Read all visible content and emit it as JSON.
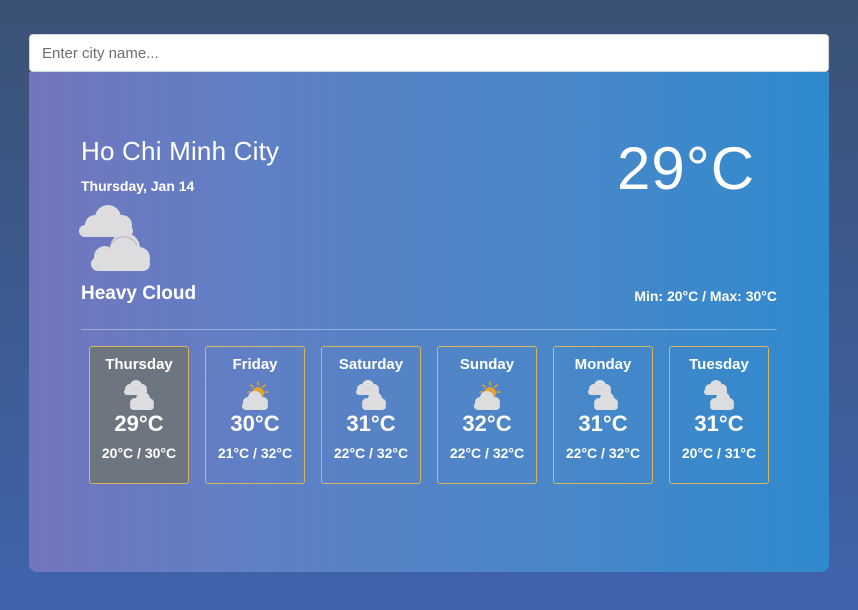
{
  "search": {
    "placeholder": "Enter city name...",
    "value": ""
  },
  "current": {
    "city": "Ho Chi Minh City",
    "date": "Thursday, Jan 14",
    "icon": "heavy-cloud-icon",
    "condition": "Heavy Cloud",
    "temperature": "29°C",
    "min_max": "Min: 20°C / Max: 30°C"
  },
  "forecast": [
    {
      "day": "Thursday",
      "icon": "heavy-cloud-icon",
      "temp": "29°C",
      "range": "20°C / 30°C",
      "selected": true
    },
    {
      "day": "Friday",
      "icon": "light-cloud-icon",
      "temp": "30°C",
      "range": "21°C / 32°C",
      "selected": false
    },
    {
      "day": "Saturday",
      "icon": "heavy-cloud-icon",
      "temp": "31°C",
      "range": "22°C / 32°C",
      "selected": false
    },
    {
      "day": "Sunday",
      "icon": "light-cloud-icon",
      "temp": "32°C",
      "range": "22°C / 32°C",
      "selected": false
    },
    {
      "day": "Monday",
      "icon": "heavy-cloud-icon",
      "temp": "31°C",
      "range": "22°C / 32°C",
      "selected": false
    },
    {
      "day": "Tuesday",
      "icon": "heavy-cloud-icon",
      "temp": "31°C",
      "range": "20°C / 31°C",
      "selected": false
    }
  ],
  "colors": {
    "card_gradient_start": "#7376be",
    "card_gradient_end": "#2f8acd",
    "forecast_border": "#d9b45a",
    "selected_day_bg": "#6d7580",
    "cloud": "#dddde0",
    "sun": "#e6a12e"
  }
}
